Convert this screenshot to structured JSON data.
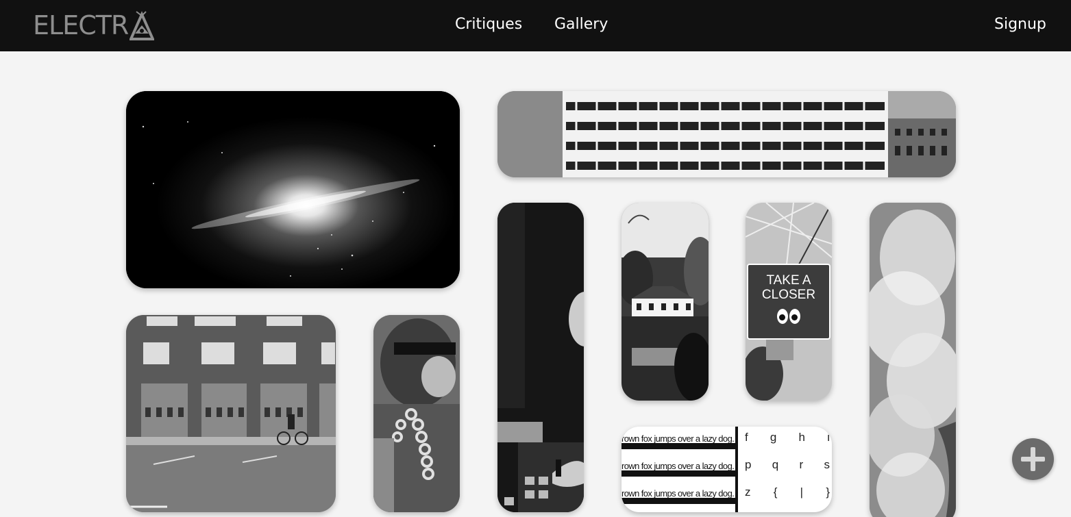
{
  "header": {
    "logo_text": "ELECTR",
    "nav": {
      "critiques": "Critiques",
      "gallery": "Gallery"
    },
    "signup": "Signup"
  },
  "gallery": {
    "closer_badge": {
      "line1": "TAKE A",
      "line2": "CLOSER"
    },
    "font_specimen": {
      "rows": [
        "rown fox jumps over a lazy dog.",
        "rown fox jumps over a lazy dog.",
        "rown fox jumps over a lazy dog."
      ],
      "glyph_rows": [
        [
          "f",
          "g",
          "h",
          "i"
        ],
        [
          "p",
          "q",
          "r",
          "s"
        ],
        [
          "z",
          "{",
          "|",
          "}"
        ]
      ]
    }
  },
  "fab": {
    "icon": "plus-icon"
  }
}
